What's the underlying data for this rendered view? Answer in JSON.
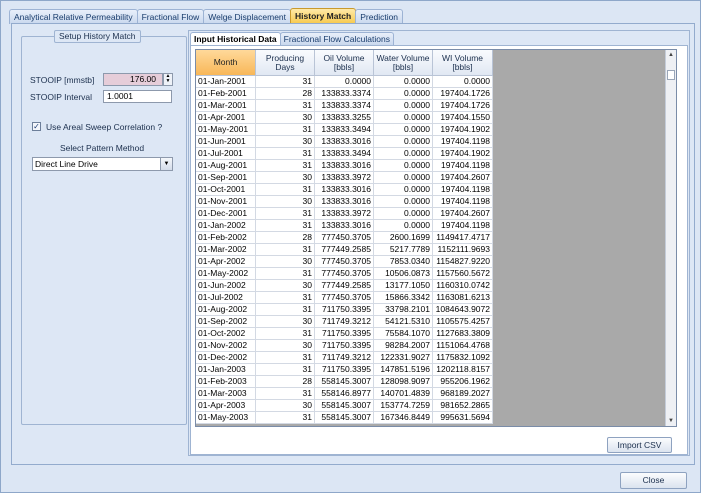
{
  "main_tabs": [
    "Analytical Relative Permeability",
    "Fractional Flow",
    "Welge Displacement",
    "History Match",
    "Prediction"
  ],
  "setup": {
    "title": "Setup History Match",
    "stooip_label": "STOOIP [mmstb]",
    "stooip_value": "176.00",
    "interval_label": "STOOIP Interval",
    "interval_value": "1.0001",
    "checkbox_label": "Use Areal Sweep Correlation ?",
    "checkbox_checked": true,
    "pattern_label": "Select Pattern Method",
    "pattern_value": "Direct Line Drive"
  },
  "sub_tabs": [
    "Input Historical Data",
    "Fractional Flow Calculations"
  ],
  "table": {
    "headers": [
      "Month",
      "Producing\nDays",
      "Oil Volume\n[bbls]",
      "Water Volume\n[bbls]",
      "WI Volume\n[bbls]"
    ],
    "rows": [
      [
        "01-Jan-2001",
        "31",
        "0.0000",
        "0.0000",
        "0.0000"
      ],
      [
        "01-Feb-2001",
        "28",
        "133833.3374",
        "0.0000",
        "197404.1726"
      ],
      [
        "01-Mar-2001",
        "31",
        "133833.3374",
        "0.0000",
        "197404.1726"
      ],
      [
        "01-Apr-2001",
        "30",
        "133833.3255",
        "0.0000",
        "197404.1550"
      ],
      [
        "01-May-2001",
        "31",
        "133833.3494",
        "0.0000",
        "197404.1902"
      ],
      [
        "01-Jun-2001",
        "30",
        "133833.3016",
        "0.0000",
        "197404.1198"
      ],
      [
        "01-Jul-2001",
        "31",
        "133833.3494",
        "0.0000",
        "197404.1902"
      ],
      [
        "01-Aug-2001",
        "31",
        "133833.3016",
        "0.0000",
        "197404.1198"
      ],
      [
        "01-Sep-2001",
        "30",
        "133833.3972",
        "0.0000",
        "197404.2607"
      ],
      [
        "01-Oct-2001",
        "31",
        "133833.3016",
        "0.0000",
        "197404.1198"
      ],
      [
        "01-Nov-2001",
        "30",
        "133833.3016",
        "0.0000",
        "197404.1198"
      ],
      [
        "01-Dec-2001",
        "31",
        "133833.3972",
        "0.0000",
        "197404.2607"
      ],
      [
        "01-Jan-2002",
        "31",
        "133833.3016",
        "0.0000",
        "197404.1198"
      ],
      [
        "01-Feb-2002",
        "28",
        "777450.3705",
        "2600.1699",
        "1149417.4717"
      ],
      [
        "01-Mar-2002",
        "31",
        "777449.2585",
        "5217.7789",
        "1152111.9693"
      ],
      [
        "01-Apr-2002",
        "30",
        "777450.3705",
        "7853.0340",
        "1154827.9220"
      ],
      [
        "01-May-2002",
        "31",
        "777450.3705",
        "10506.0873",
        "1157560.5672"
      ],
      [
        "01-Jun-2002",
        "30",
        "777449.2585",
        "13177.1050",
        "1160310.0742"
      ],
      [
        "01-Jul-2002",
        "31",
        "777450.3705",
        "15866.3342",
        "1163081.6213"
      ],
      [
        "01-Aug-2002",
        "31",
        "711750.3395",
        "33798.2101",
        "1084643.9072"
      ],
      [
        "01-Sep-2002",
        "30",
        "711749.3212",
        "54121.5310",
        "1105575.4257"
      ],
      [
        "01-Oct-2002",
        "31",
        "711750.3395",
        "75584.1070",
        "1127683.3809"
      ],
      [
        "01-Nov-2002",
        "30",
        "711750.3395",
        "98284.2007",
        "1151064.4768"
      ],
      [
        "01-Dec-2002",
        "31",
        "711749.3212",
        "122331.9027",
        "1175832.1092"
      ],
      [
        "01-Jan-2003",
        "31",
        "711750.3395",
        "147851.5196",
        "1202118.8157"
      ],
      [
        "01-Feb-2003",
        "28",
        "558145.3007",
        "128098.9097",
        "955206.1962"
      ],
      [
        "01-Mar-2003",
        "31",
        "558146.8977",
        "140701.4839",
        "968189.2027"
      ],
      [
        "01-Apr-2003",
        "30",
        "558145.3007",
        "153774.7259",
        "981652.2865"
      ],
      [
        "01-May-2003",
        "31",
        "558145.3007",
        "167346.8449",
        "995631.5694"
      ]
    ]
  },
  "buttons": {
    "import_csv": "Import CSV",
    "close": "Close"
  },
  "colors": {
    "accent_tab": "#f7c94c",
    "stooip_field": "#e6cdd9",
    "grid_empty": "#a9a9a9"
  }
}
